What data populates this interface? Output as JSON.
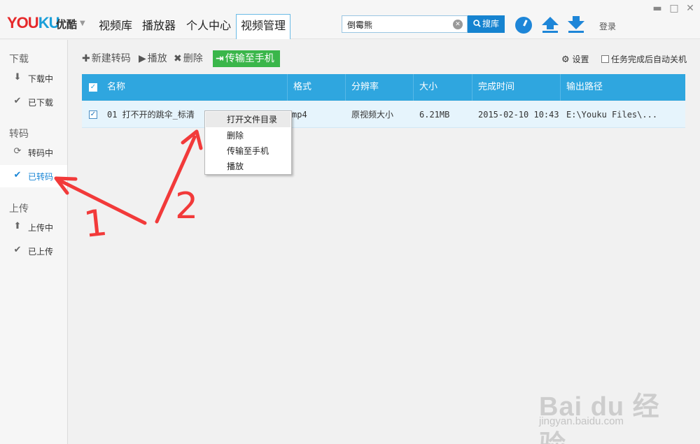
{
  "header": {
    "logo_part1": "YOU",
    "logo_part2": "KU",
    "logo_cn": "优酷",
    "nav": [
      {
        "label": "视频库"
      },
      {
        "label": "播放器"
      },
      {
        "label": "个人中心"
      },
      {
        "label": "视频管理"
      }
    ],
    "search": {
      "value": "倒霉熊",
      "button_label": "搜库"
    },
    "login_label": "登录",
    "accent_color": "#1683d0"
  },
  "sidebar": {
    "groups": [
      {
        "title": "下载",
        "items": [
          {
            "label": "下载中",
            "icon": "download-icon"
          },
          {
            "label": "已下载",
            "icon": "check-icon"
          }
        ]
      },
      {
        "title": "转码",
        "items": [
          {
            "label": "转码中",
            "icon": "transcode-icon"
          },
          {
            "label": "已转码",
            "icon": "check-icon",
            "active": true
          }
        ]
      },
      {
        "title": "上传",
        "items": [
          {
            "label": "上传中",
            "icon": "upload-icon"
          },
          {
            "label": "已上传",
            "icon": "check-icon"
          }
        ]
      }
    ]
  },
  "toolbar": {
    "new_label": "新建转码",
    "play_label": "播放",
    "delete_label": "删除",
    "transfer_label": "传输至手机",
    "settings_label": "设置",
    "shutdown_label": "任务完成后自动关机",
    "transfer_color": "#3ab64a"
  },
  "table": {
    "header_color": "#2fa6df",
    "columns": [
      "名称",
      "格式",
      "分辨率",
      "大小",
      "完成时间",
      "输出路径"
    ],
    "rows": [
      {
        "checked": true,
        "name": "01 打不开的跳伞_标清",
        "format": "mp4",
        "resolution": "原视频大小",
        "size": "6.21MB",
        "completed": "2015-02-10 10:43",
        "path": "E:\\Youku Files\\..."
      }
    ]
  },
  "context_menu": {
    "items": [
      "打开文件目录",
      "删除",
      "传输至手机",
      "播放"
    ]
  },
  "annotation": {
    "labels": [
      "1",
      "2"
    ],
    "color": "#f23a3a"
  },
  "watermark": {
    "brand": "Bai du 经验",
    "sub": "jingyan.baidu.com"
  }
}
